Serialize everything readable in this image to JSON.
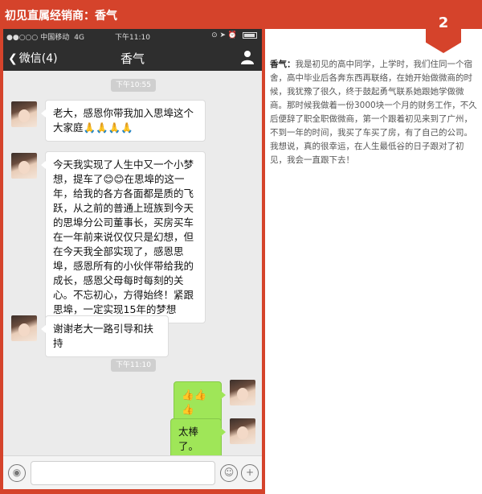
{
  "header": {
    "title": "初见直属经销商：香气",
    "badge_number": "2",
    "color": "#d5432b"
  },
  "statusbar": {
    "signal": "●●○○○",
    "carrier": "中国移动",
    "network": "4G",
    "time": "下午11:10"
  },
  "navbar": {
    "back_label": "微信(4)",
    "title": "香气",
    "user_icon": "user-icon"
  },
  "chat": {
    "time1": "下午10:55",
    "messages_before": [
      {
        "side": "left",
        "text": "老大，感恩你带我加入思埠这个大家庭🙏🙏🙏🙏"
      },
      {
        "side": "left",
        "text": "今天我实现了人生中又一个小梦想，提车了😊😊在思埠的这一年，给我的各方各面都是质的飞跃，从之前的普通上班族到今天的思埠分公司董事长，买房买车在一年前来说仅仅只是幻想，但在今天我全部实现了，感恩思埠，感恩所有的小伙伴带给我的成长，感恩父母每时每刻的关心。不忘初心，方得始终！紧跟思埠，一定实现15年的梦想"
      },
      {
        "side": "left",
        "text": "谢谢老大一路引导和扶持"
      }
    ],
    "time2": "下午11:10",
    "messages_after": [
      {
        "side": "right",
        "text": "👍👍👍"
      },
      {
        "side": "right",
        "text": "太棒了。"
      }
    ]
  },
  "inputbar": {
    "voice_icon": "voice-icon",
    "emoji_icon": "emoji-icon",
    "plus_icon": "plus-icon"
  },
  "story": {
    "name": "香气：",
    "text": "我是初见的高中同学，上学时，我们住同一个宿舍，高中毕业后各奔东西再联络，在她开始做微商的时候，我犹豫了很久，终于鼓起勇气联系她跟她学做微商。那时候我做着一份3000块一个月的财务工作，不久后便辞了职全职做微商，第一个跟着初见来到了广州，不到一年的时间，我买了车买了房，有了自己的公司。我想说，真的很幸运，在人生最低谷的日子跟对了初见，我会一直跟下去！"
  }
}
